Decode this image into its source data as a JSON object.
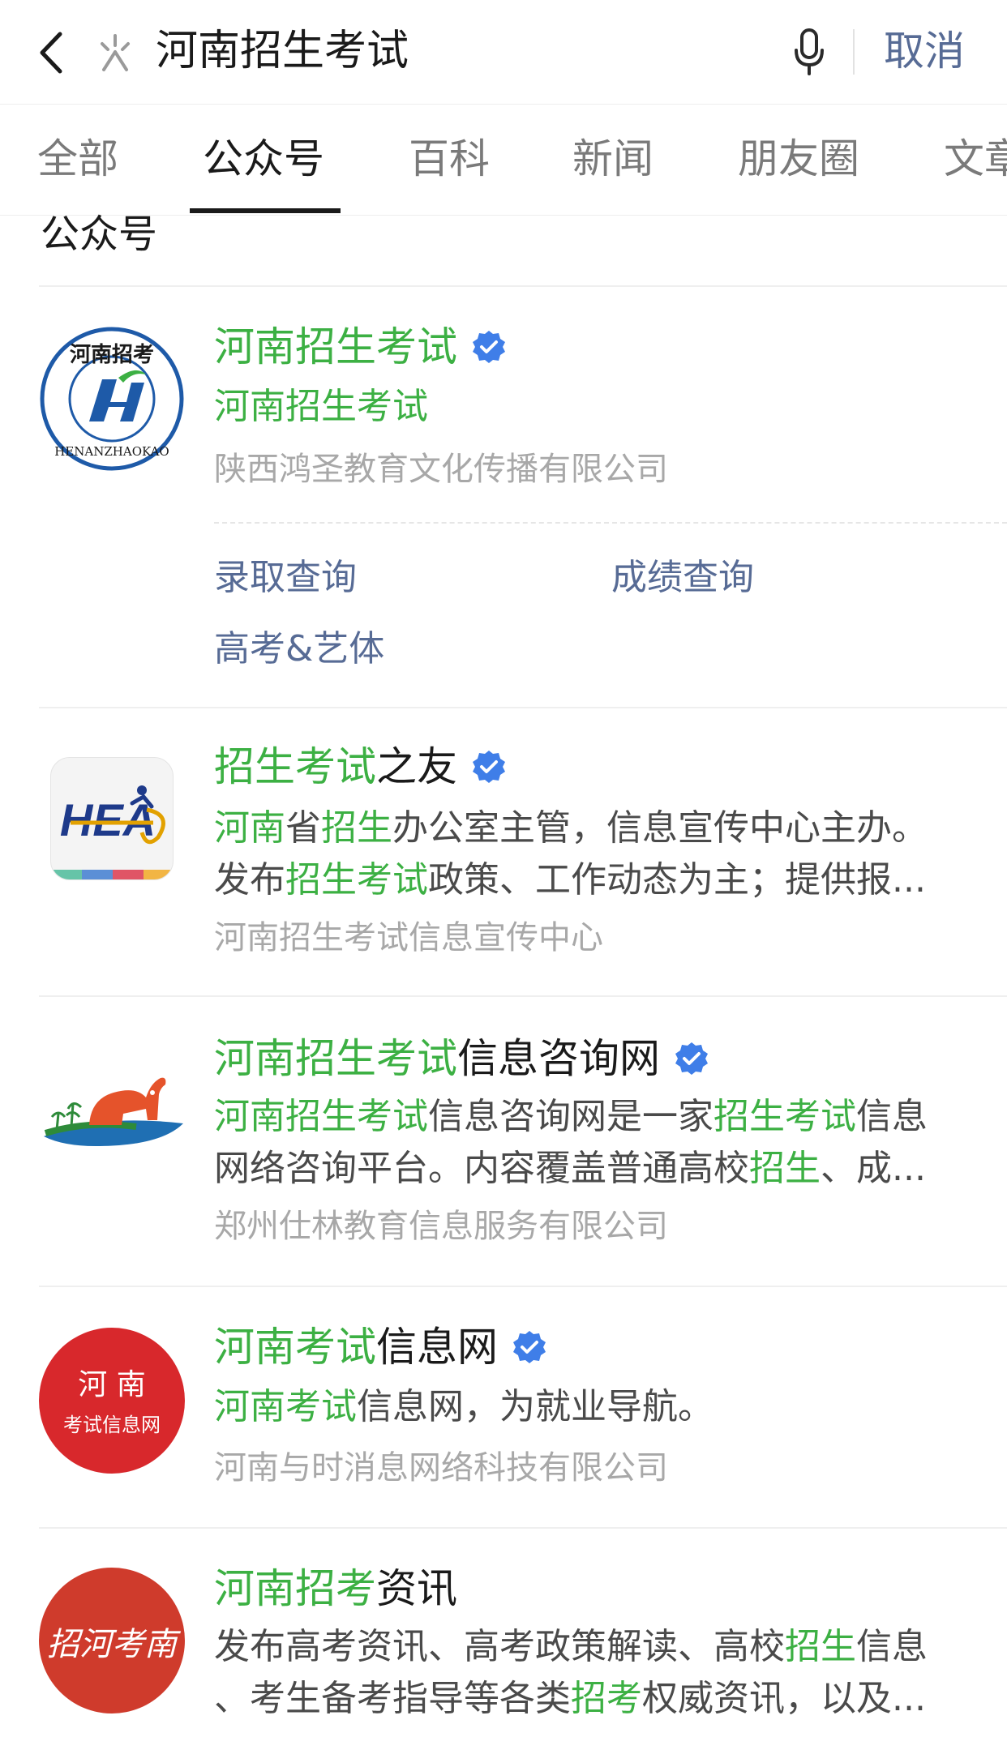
{
  "search": {
    "query": "河南招生考试",
    "cancel_label": "取消"
  },
  "tabs": [
    {
      "label": "全部",
      "active": false
    },
    {
      "label": "公众号",
      "active": true
    },
    {
      "label": "百科",
      "active": false
    },
    {
      "label": "新闻",
      "active": false
    },
    {
      "label": "朋友圈",
      "active": false
    },
    {
      "label": "文章",
      "active": false
    }
  ],
  "section_title": "公众号",
  "results": [
    {
      "name_highlight": "河南招生考试",
      "name_rest": "",
      "verified": true,
      "desc_lines": [
        {
          "hl": "河南招生考试",
          "rest": ""
        }
      ],
      "company": "陕西鸿圣教育文化传播有限公司",
      "avatar": {
        "ring_text": "河南招考",
        "bottom_text": "HENANZHAOKAO",
        "colors": [
          "#1e5aa8",
          "#3cb043"
        ]
      },
      "services": [
        "录取查询",
        "成绩查询",
        "高考&艺体"
      ]
    },
    {
      "name_highlight": "招生考试",
      "name_rest": "之友",
      "verified": true,
      "desc_lines": [
        {
          "parts": [
            {
              "t": "河南",
              "h": true
            },
            {
              "t": "省",
              "h": false
            },
            {
              "t": "招生",
              "h": true
            },
            {
              "t": "办公室主管，信息宣传中心主办。",
              "h": false
            }
          ]
        },
        {
          "parts": [
            {
              "t": "发布",
              "h": false
            },
            {
              "t": "招生考试",
              "h": true
            },
            {
              "t": "政策、工作动态为主；提供报...",
              "h": false
            }
          ]
        }
      ],
      "company": "河南招生考试信息宣传中心",
      "avatar": {
        "logo_text": "HEA"
      }
    },
    {
      "name_highlight": "河南招生考试",
      "name_rest": "信息咨询网",
      "verified": true,
      "desc_lines": [
        {
          "parts": [
            {
              "t": "河南招生考试",
              "h": true
            },
            {
              "t": "信息咨询网是一家",
              "h": false
            },
            {
              "t": "招生考试",
              "h": true
            },
            {
              "t": "信息",
              "h": false
            }
          ]
        },
        {
          "parts": [
            {
              "t": "网络咨询平台。内容覆盖普通高校",
              "h": false
            },
            {
              "t": "招生",
              "h": true
            },
            {
              "t": "、成...",
              "h": false
            }
          ]
        }
      ],
      "company": "郑州仕林教育信息服务有限公司"
    },
    {
      "name_highlight": "河南考试",
      "name_rest": "信息网",
      "verified": true,
      "desc_lines": [
        {
          "parts": [
            {
              "t": "河南考试",
              "h": true
            },
            {
              "t": "信息网，为就业导航。",
              "h": false
            }
          ]
        }
      ],
      "company": "河南与时消息网络科技有限公司",
      "avatar": {
        "line1": "河 南",
        "line2": "考试信息网",
        "color": "#d8282c"
      }
    },
    {
      "name_highlight": "河南招考",
      "name_rest": "资讯",
      "verified": false,
      "desc_lines": [
        {
          "parts": [
            {
              "t": "发布高考资讯、高考政策解读、高校",
              "h": false
            },
            {
              "t": "招生",
              "h": true
            },
            {
              "t": "信息",
              "h": false
            }
          ]
        },
        {
          "parts": [
            {
              "t": "、考生备考指导等各类",
              "h": false
            },
            {
              "t": "招考",
              "h": true
            },
            {
              "t": "权威资讯，以及...",
              "h": false
            }
          ]
        }
      ],
      "avatar": {
        "text": "招河考南",
        "color": "#cf3b2c"
      }
    }
  ],
  "colors": {
    "highlight": "#3cb043",
    "link": "#576b95",
    "verified": "#3f7ee8"
  }
}
